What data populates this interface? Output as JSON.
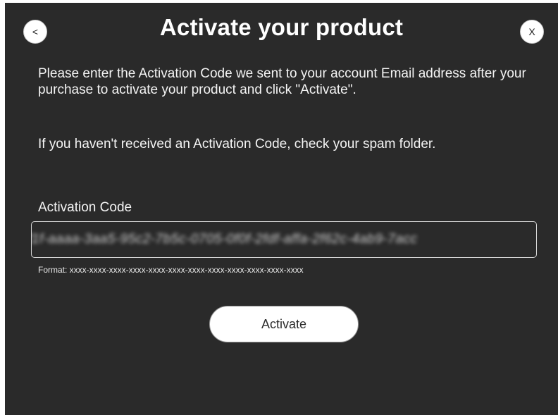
{
  "dialog": {
    "back_icon_glyph": "<",
    "close_icon_glyph": "X",
    "title": "Activate your product",
    "instructions": "Please enter the Activation Code we sent to your account Email address after your purchase to activate your product and click \"Activate\".",
    "spam_note": "If you haven't received an Activation Code, check your spam folder.",
    "code_field": {
      "label": "Activation Code",
      "value": "f1f-aaaa-3aa5-95c2-7b5c-0705-0f0f-2fdf-affa-2f62c-4ab9-7acc",
      "format_hint": "Format: xxxx-xxxx-xxxx-xxxx-xxxx-xxxx-xxxx-xxxx-xxxx-xxxx-xxxx-xxxx"
    },
    "activate_label": "Activate"
  },
  "colors": {
    "background": "#2a2a2a",
    "text": "#ffffff",
    "button_bg": "#ffffff"
  }
}
